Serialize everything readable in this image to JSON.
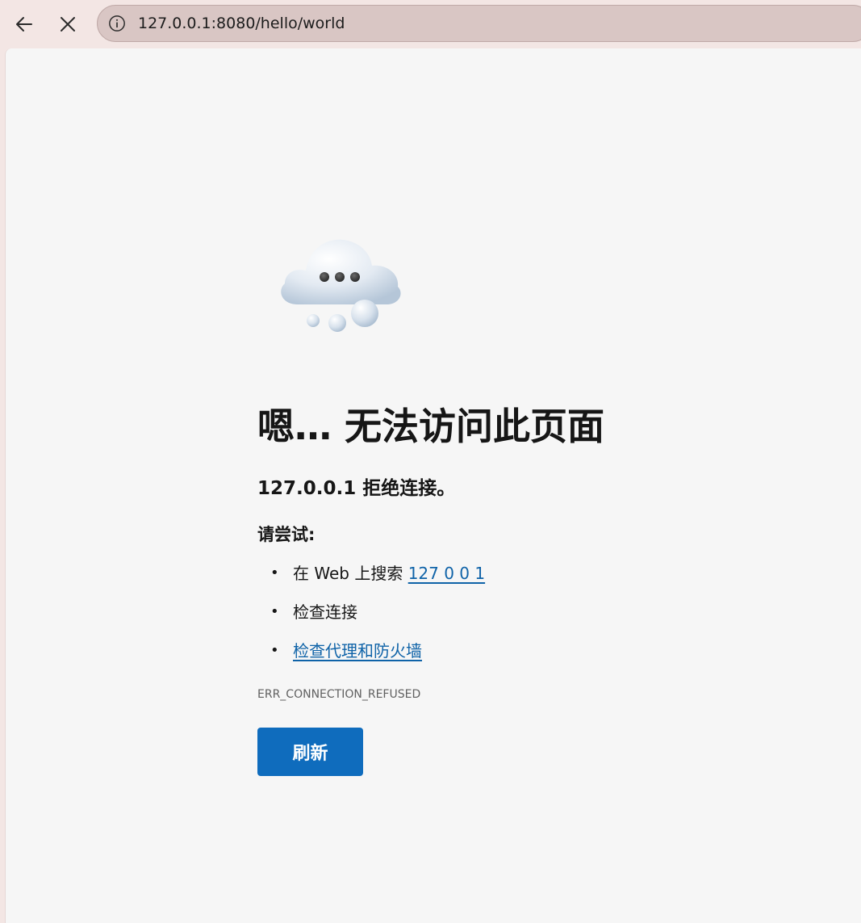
{
  "browser": {
    "back_icon": "arrow-left-icon",
    "stop_icon": "close-icon",
    "site_info_icon": "info-icon",
    "url": "127.0.0.1:8080/hello/world"
  },
  "error_page": {
    "illustration_icon": "cloud-thinking-icon",
    "title": "嗯… 无法访问此页面",
    "subtitle": "127.0.0.1 拒绝连接。",
    "try_label": "请尝试:",
    "suggestions": [
      {
        "prefix": "在 Web 上搜索 ",
        "link": "127 0 0 1"
      },
      {
        "text": "检查连接"
      },
      {
        "link": "检查代理和防火墙"
      }
    ],
    "error_code": "ERR_CONNECTION_REFUSED",
    "refresh_label": "刷新",
    "colors": {
      "accent": "#0f6cbd",
      "link": "#0f63a8",
      "background": "#f6f6f6"
    }
  }
}
